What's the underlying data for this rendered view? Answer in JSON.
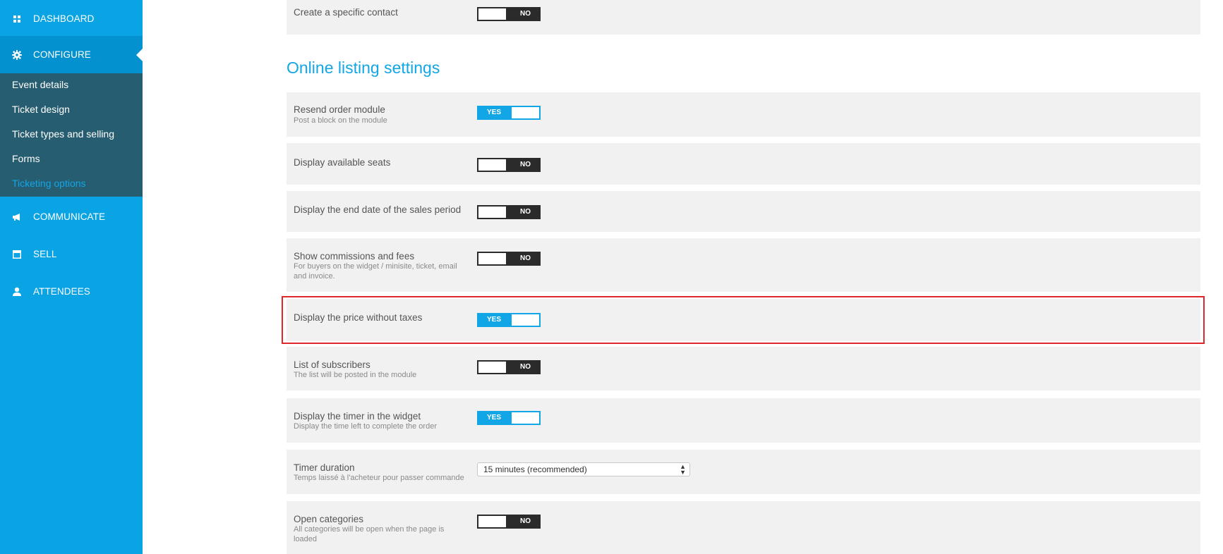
{
  "sidebar": {
    "dashboard": {
      "label": "DASHBOARD",
      "icon": "grid-icon"
    },
    "configure": {
      "label": "CONFIGURE",
      "icon": "gear-icon"
    },
    "configure_items": [
      {
        "label": "Event details"
      },
      {
        "label": "Ticket design"
      },
      {
        "label": "Ticket types and selling"
      },
      {
        "label": "Forms"
      },
      {
        "label": "Ticketing options"
      }
    ],
    "communicate": {
      "label": "COMMUNICATE",
      "icon": "megaphone-icon"
    },
    "sell": {
      "label": "SELL",
      "icon": "store-icon"
    },
    "attendees": {
      "label": "ATTENDEES",
      "icon": "person-icon"
    }
  },
  "top_row": {
    "label": "Create a specific contact",
    "toggle": "NO"
  },
  "section_title": "Online listing settings",
  "settings": [
    {
      "label": "Resend order module",
      "description": "Post a block on the module",
      "toggle": "YES"
    },
    {
      "label": "Display available seats",
      "description": "",
      "toggle": "NO"
    },
    {
      "label": "Display the end date of the sales period",
      "description": "",
      "toggle": "NO"
    },
    {
      "label": "Show commissions and fees",
      "description": "For buyers on the widget / minisite, ticket, email and invoice.",
      "toggle": "NO"
    },
    {
      "label": "Display the price without taxes",
      "description": "",
      "toggle": "YES"
    },
    {
      "label": "List of subscribers",
      "description": "The list will be posted in the module",
      "toggle": "NO"
    },
    {
      "label": "Display the timer in the widget",
      "description": "Display the time left to complete the order",
      "toggle": "YES"
    },
    {
      "label": "Timer duration",
      "description": "Temps laissé à l'acheteur pour passer commande",
      "select_value": "15 minutes (recommended)"
    },
    {
      "label": "Open categories",
      "description": "All categories will be open when the page is loaded",
      "toggle": "NO"
    }
  ],
  "colors": {
    "accent": "#12a6e6",
    "sidebar": "#0aa3e4",
    "submenu": "#275d70",
    "highlight": "#e0252b"
  }
}
